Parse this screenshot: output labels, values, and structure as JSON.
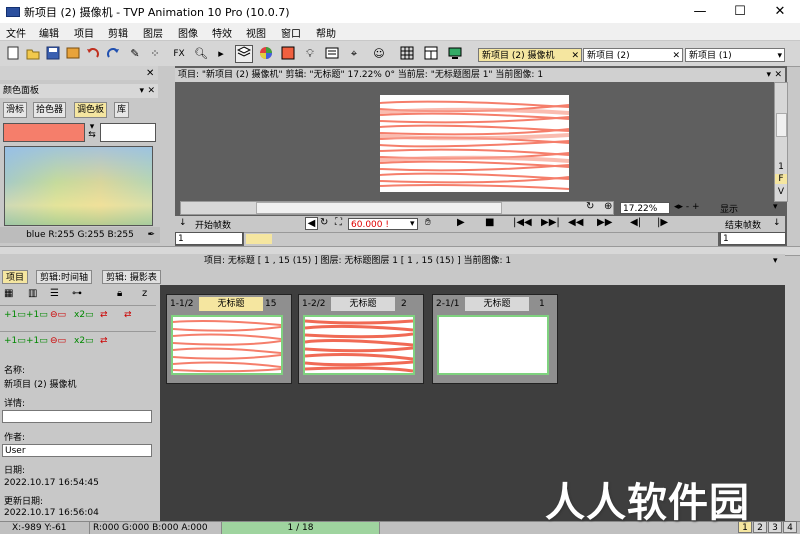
{
  "window": {
    "title": "新项目 (2) 摄像机 - TVP Animation 10 Pro (10.0.7)",
    "min": "—",
    "max": "☐",
    "close": "✕"
  },
  "menu": [
    "文件",
    "编辑",
    "项目",
    "剪辑",
    "图层",
    "图像",
    "特效",
    "视图",
    "窗口",
    "帮助"
  ],
  "toolbar": {
    "fx_label": "FX"
  },
  "doc_tabs": [
    {
      "label": "新项目 (2) 摄像机"
    },
    {
      "label": "新项目 (2)"
    },
    {
      "label": "新项目 (1)"
    }
  ],
  "color_panel": {
    "title": "颜色面板",
    "subtabs": [
      "滑标",
      "拾色器",
      "调色板",
      "库"
    ],
    "readout": "blue R:255 G:255 B:255"
  },
  "viewer": {
    "info": "项目: \"新项目 (2) 摄像机\"   剪辑: \"无标题\"    17.22%    0°   当前层: \"无标题图层 1\"   当前图像: 1",
    "zoom": "17.22%",
    "display_label": "显示",
    "fps": "60.000 !",
    "start_label": "开始帧数",
    "end_label": "结束帧数",
    "start_value": "1",
    "end_value": "1",
    "side_letters": [
      "1",
      "F",
      "V"
    ]
  },
  "project_info": "项目: 无标题 [ 1 , 15  (15) ]       图层: 无标题图层 1 [ 1 , 15  (15) ]    当前图像: 1",
  "lower_tabs": [
    "项目",
    "剪辑:时间轴",
    "剪辑: 摄影表"
  ],
  "project_panel": {
    "name_label": "名称:",
    "name_value": "新项目 (2) 摄像机",
    "details_label": "详情:",
    "details_value": "",
    "author_label": "作者:",
    "author_value": "User",
    "date_label": "日期:",
    "date_value": "2022.10.17 16:54:45",
    "updated_label": "更新日期:",
    "updated_value": "2022.10.17 16:56:04"
  },
  "clips": [
    {
      "index": "1-1/2",
      "name": "无标题",
      "count": "15"
    },
    {
      "index": "1-2/2",
      "name": "无标题",
      "count": "2"
    },
    {
      "index": "2-1/1",
      "name": "无标题",
      "count": "1"
    }
  ],
  "status": {
    "coords": "X:-989  Y:-61",
    "color": "R:000 G:000 B:000 A:000",
    "frame": "1 / 18",
    "pages": [
      "1",
      "2",
      "3",
      "4"
    ]
  },
  "watermark": "人人软件园",
  "colors": {
    "accent": "#f57e6b",
    "tab_active": "#f5e6a0",
    "thumb_border": "#7fd27f"
  }
}
